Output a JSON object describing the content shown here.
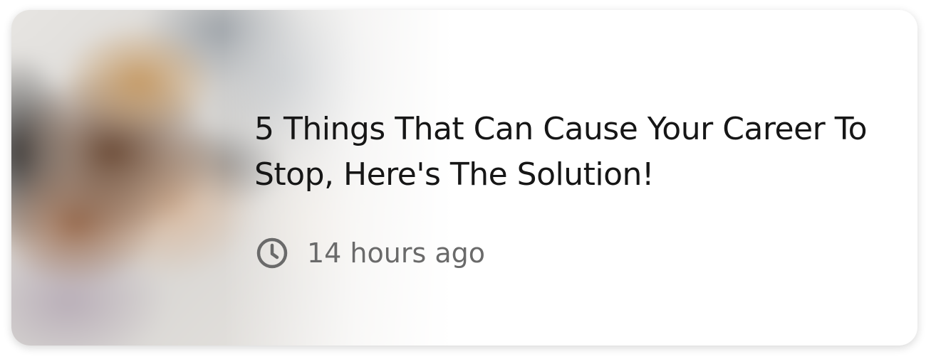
{
  "article_card": {
    "title": "5 Things That Can Cause Your Career To Stop, Here's The Solution!",
    "timestamp": "14 hours ago",
    "thumbnail_icon": "blurred-photo-person-holding-head",
    "meta_icon": "clock-icon",
    "colors": {
      "title": "#161616",
      "meta": "#6a6a6a",
      "background": "#ffffff"
    }
  }
}
